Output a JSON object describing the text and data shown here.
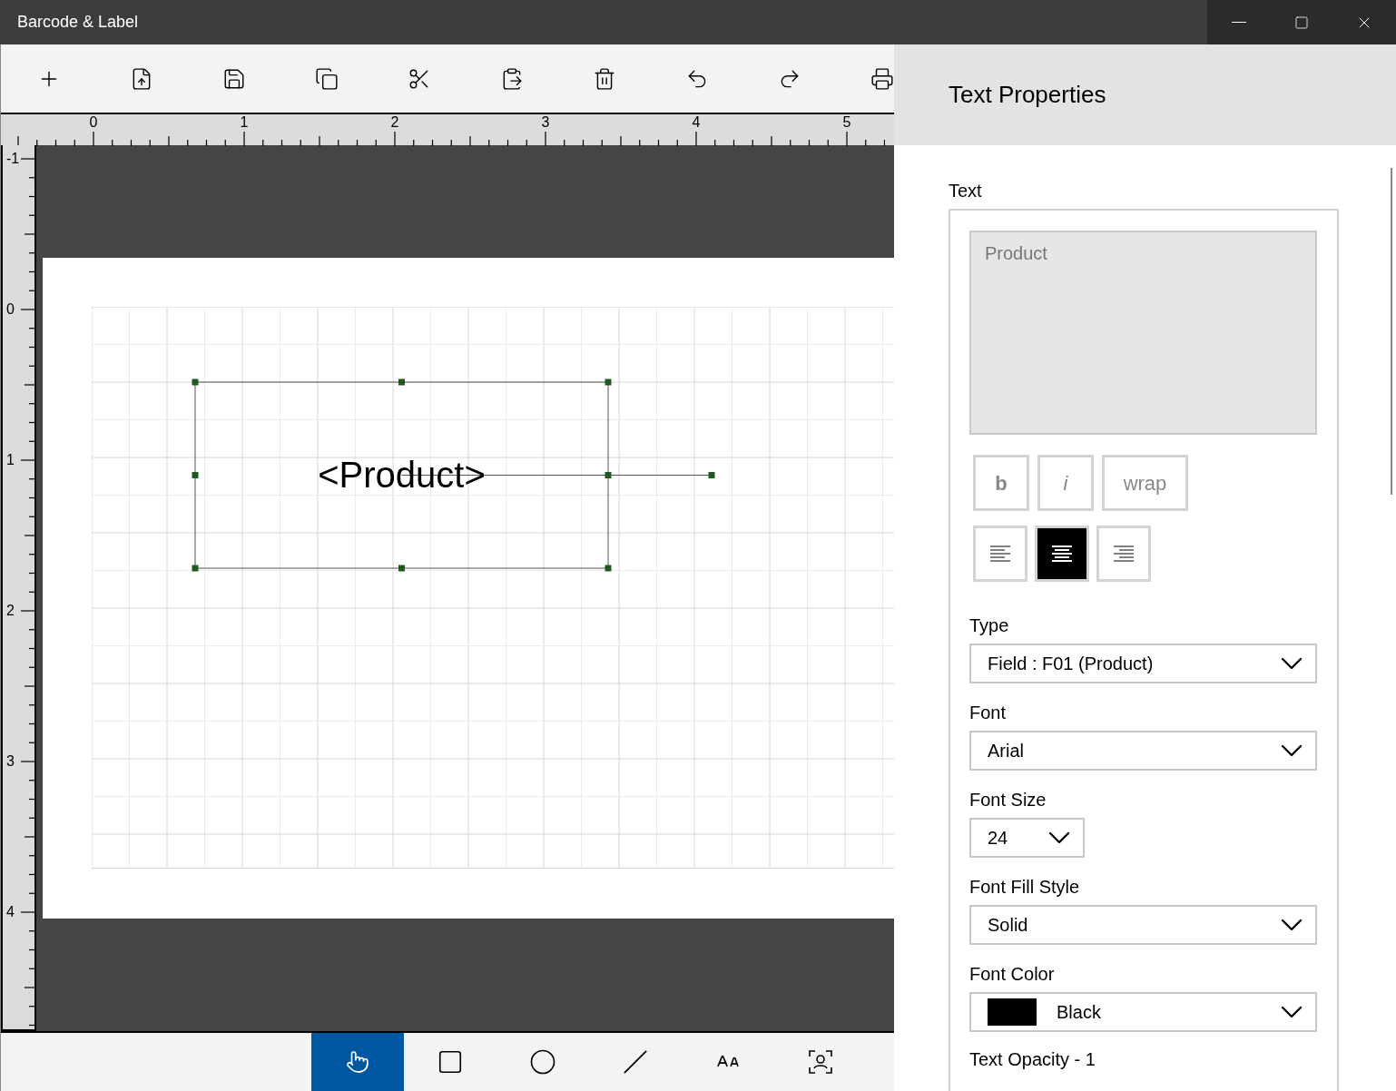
{
  "window": {
    "title": "Barcode & Label"
  },
  "toolbar": [
    {
      "kind": "add"
    },
    {
      "kind": "import"
    },
    {
      "kind": "save"
    },
    {
      "kind": "copy"
    },
    {
      "kind": "cut"
    },
    {
      "kind": "paste"
    },
    {
      "kind": "delete"
    },
    {
      "kind": "undo"
    },
    {
      "kind": "redo"
    },
    {
      "kind": "print"
    }
  ],
  "rulers": {
    "horizontal": [
      "0",
      "1",
      "2",
      "3",
      "4",
      "5"
    ],
    "vertical": [
      "-1",
      "0",
      "1",
      "2",
      "3",
      "4"
    ]
  },
  "canvas": {
    "elements": [
      {
        "text": "<Product>",
        "selected": true
      }
    ]
  },
  "tools": [
    {
      "kind": "pointer",
      "selected": true
    },
    {
      "kind": "rectangle",
      "selected": false
    },
    {
      "kind": "ellipse",
      "selected": false
    },
    {
      "kind": "line",
      "selected": false
    },
    {
      "kind": "text",
      "selected": false
    },
    {
      "kind": "image",
      "selected": false
    }
  ],
  "properties": {
    "title": "Text Properties",
    "text_label": "Text",
    "text_value": "Product",
    "format_buttons": [
      {
        "label": "b",
        "kind": "bold",
        "selected": false
      },
      {
        "label": "i",
        "kind": "italic",
        "selected": false
      },
      {
        "label": "wrap",
        "kind": "wrap",
        "selected": false
      }
    ],
    "align_buttons": [
      {
        "kind": "left",
        "selected": false
      },
      {
        "kind": "center",
        "selected": true
      },
      {
        "kind": "right",
        "selected": false
      }
    ],
    "fields": [
      {
        "label": "Type",
        "value": "Field : F01 (Product)",
        "kind": "wide"
      },
      {
        "label": "Font",
        "value": "Arial",
        "kind": "wide"
      },
      {
        "label": "Font Size",
        "value": "24",
        "kind": "narrow"
      },
      {
        "label": "Font Fill Style",
        "value": "Solid",
        "kind": "wide"
      },
      {
        "label": "Font Color",
        "value": "Black",
        "kind": "color",
        "color": "#000000"
      }
    ],
    "opacity_label": "Text Opacity - 1"
  }
}
